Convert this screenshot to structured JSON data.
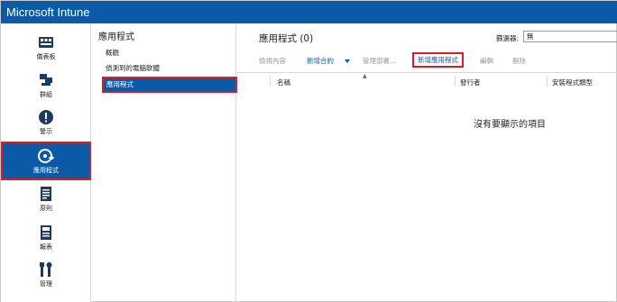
{
  "app": {
    "title": "Microsoft Intune"
  },
  "leftnav": {
    "items": [
      {
        "label": "儀表板",
        "icon": "dashboard-icon"
      },
      {
        "label": "群組",
        "icon": "groups-icon"
      },
      {
        "label": "警示",
        "icon": "alert-icon"
      },
      {
        "label": "應用程式",
        "icon": "apps-icon",
        "active": true
      },
      {
        "label": "原則",
        "icon": "policy-icon"
      },
      {
        "label": "報表",
        "icon": "reports-icon"
      },
      {
        "label": "管理",
        "icon": "admin-tools-icon"
      }
    ]
  },
  "secnav": {
    "title": "應用程式",
    "items": [
      {
        "label": "概觀"
      },
      {
        "label": "偵測到的電腦軟體"
      },
      {
        "label": "應用程式",
        "active": true
      }
    ]
  },
  "main": {
    "title": "應用程式 (0)",
    "filter_label": "篩選器:",
    "filter_value": "無",
    "toolbar": {
      "view": "檢視內容",
      "add_agreement": "新增合約",
      "manage_deploy": "管理部署...",
      "add_app": "新增應用程式",
      "edit": "編輯",
      "delete": "刪除"
    },
    "columns": [
      "名稱",
      "發行者",
      "安裝程式類型"
    ],
    "empty_text": "沒有要顯示的項目"
  },
  "colors": {
    "brand": "#0a5aa6",
    "highlight": "#d81e2a"
  }
}
